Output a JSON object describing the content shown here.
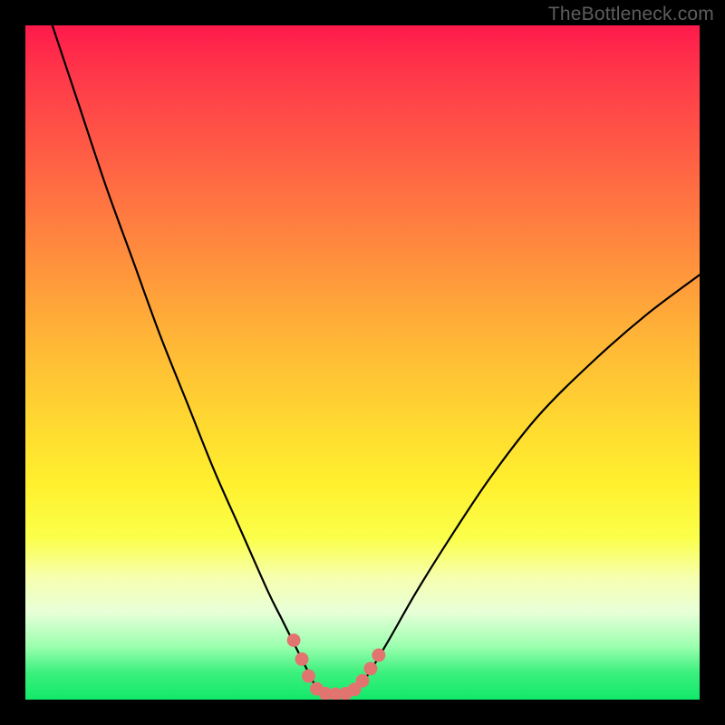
{
  "watermark": "TheBottleneck.com",
  "colors": {
    "frame": "#000000",
    "curve": "#000000",
    "marker": "#e2746f",
    "gradient_stops": [
      {
        "pos": 0.0,
        "hex": "#ff1a4b"
      },
      {
        "pos": 0.08,
        "hex": "#ff3a4a"
      },
      {
        "pos": 0.2,
        "hex": "#ff6044"
      },
      {
        "pos": 0.33,
        "hex": "#ff8a3e"
      },
      {
        "pos": 0.46,
        "hex": "#ffb437"
      },
      {
        "pos": 0.58,
        "hex": "#ffd631"
      },
      {
        "pos": 0.68,
        "hex": "#fff02e"
      },
      {
        "pos": 0.76,
        "hex": "#fbff4a"
      },
      {
        "pos": 0.82,
        "hex": "#f6ffb0"
      },
      {
        "pos": 0.87,
        "hex": "#e8ffd8"
      },
      {
        "pos": 0.92,
        "hex": "#9dffb0"
      },
      {
        "pos": 0.96,
        "hex": "#3cf07e"
      },
      {
        "pos": 1.0,
        "hex": "#12e86a"
      }
    ]
  },
  "chart_data": {
    "type": "line",
    "title": "",
    "xlabel": "",
    "ylabel": "",
    "xlim": [
      0,
      100
    ],
    "ylim": [
      0,
      100
    ],
    "series": [
      {
        "name": "left-curve",
        "x": [
          4,
          8,
          12,
          16,
          20,
          24,
          28,
          32,
          36,
          38,
          40,
          42,
          43.5
        ],
        "y": [
          100,
          88,
          76,
          65,
          54,
          44,
          34,
          25,
          16,
          12,
          8,
          4,
          1
        ]
      },
      {
        "name": "right-curve",
        "x": [
          49,
          51,
          54,
          58,
          63,
          69,
          76,
          84,
          92,
          100
        ],
        "y": [
          1,
          4,
          9,
          16,
          24,
          33,
          42,
          50,
          57,
          63
        ]
      },
      {
        "name": "valley-floor",
        "x": [
          43.5,
          45,
          47,
          49
        ],
        "y": [
          1,
          0.5,
          0.5,
          1
        ]
      }
    ],
    "markers": {
      "name": "highlight-dots",
      "points": [
        {
          "x": 39.8,
          "y": 8.8
        },
        {
          "x": 41.0,
          "y": 6.0
        },
        {
          "x": 42.0,
          "y": 3.5
        },
        {
          "x": 43.2,
          "y": 1.6
        },
        {
          "x": 44.5,
          "y": 0.9
        },
        {
          "x": 46.0,
          "y": 0.8
        },
        {
          "x": 47.5,
          "y": 0.9
        },
        {
          "x": 48.8,
          "y": 1.5
        },
        {
          "x": 50.0,
          "y": 2.8
        },
        {
          "x": 51.2,
          "y": 4.6
        },
        {
          "x": 52.4,
          "y": 6.6
        }
      ],
      "radius": 1.0
    }
  }
}
